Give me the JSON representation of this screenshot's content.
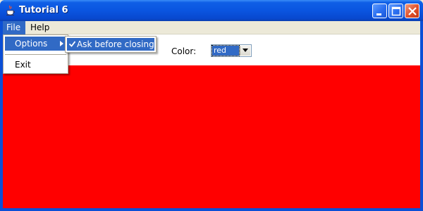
{
  "window": {
    "title": "Tutorial 6",
    "icon": "java-cup-icon",
    "controls": [
      "minimize-icon",
      "maximize-icon",
      "close-icon"
    ]
  },
  "menubar": {
    "items": [
      {
        "label": "File",
        "state": "open"
      },
      {
        "label": "Help"
      }
    ]
  },
  "file_menu": {
    "items": [
      {
        "label": "Options",
        "has_submenu": true,
        "highlighted": true
      },
      {
        "label": "Exit"
      }
    ]
  },
  "options_submenu": {
    "items": [
      {
        "label": "Ask before closing",
        "checked": true,
        "highlighted": true
      }
    ]
  },
  "toolbar": {
    "color_label": "Color:",
    "color_selected": "red",
    "color_options": [
      "red"
    ]
  },
  "colors": {
    "canvas": "#ff0000",
    "selection": "#316ac5",
    "titlebar": "#0a55e0"
  }
}
